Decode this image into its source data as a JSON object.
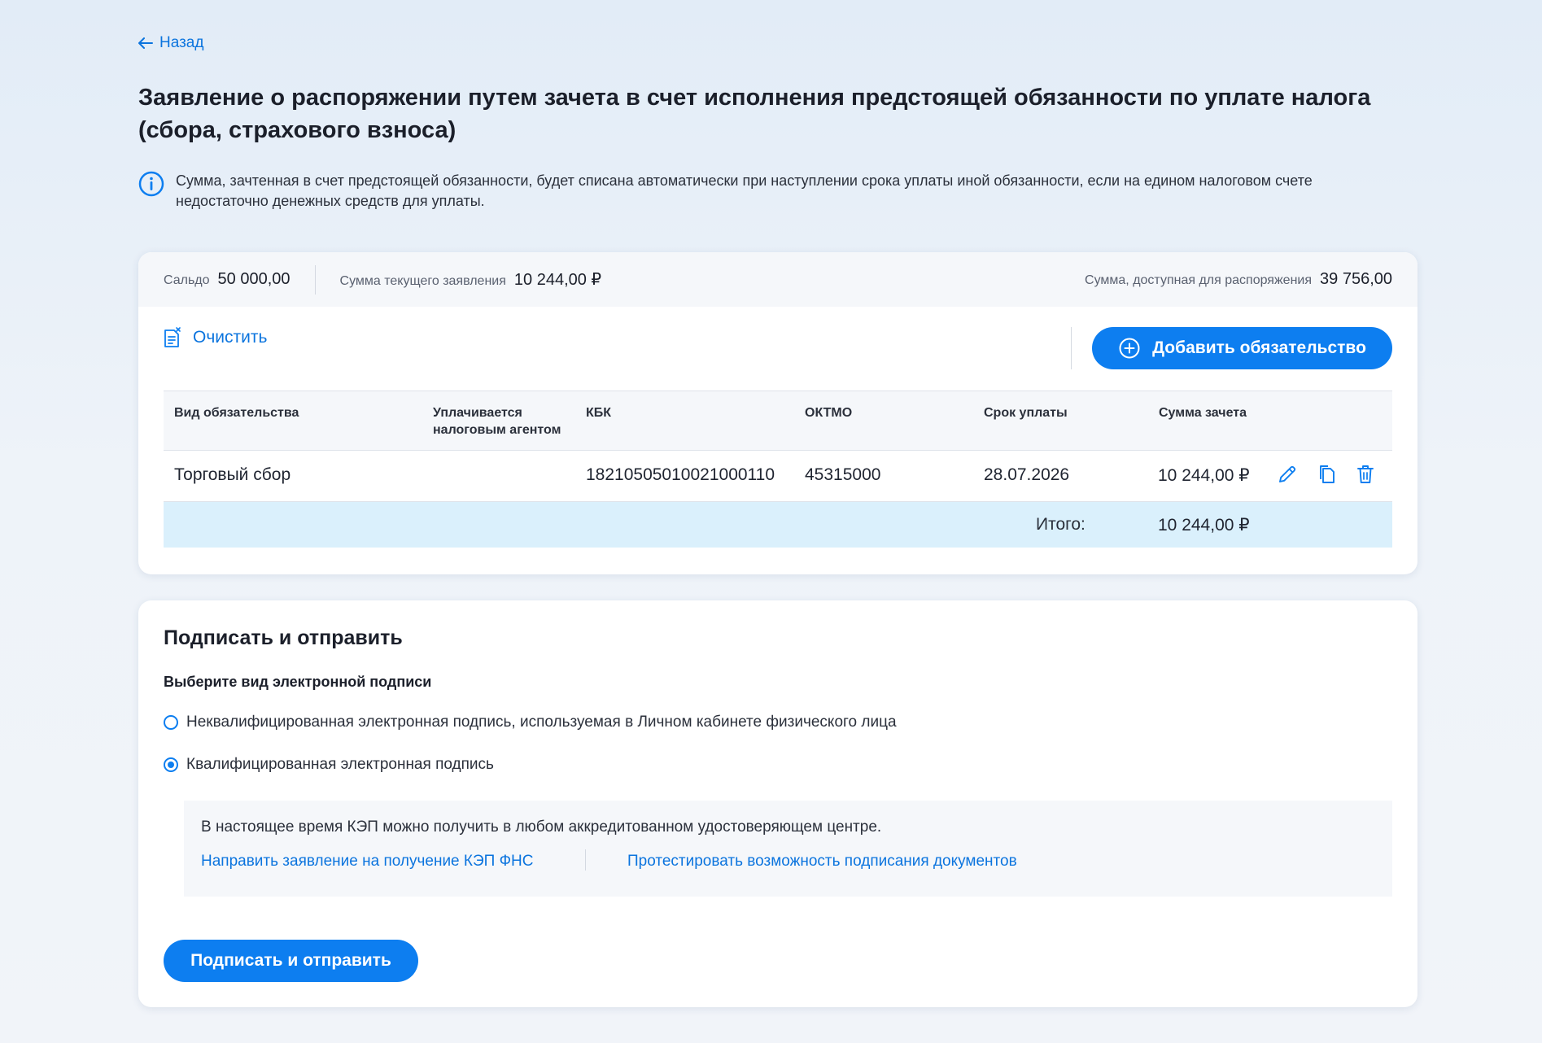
{
  "back_label": "Назад",
  "page_title": "Заявление о распоряжении путем зачета в счет исполнения предстоящей обязанности по уплате налога (сбора, страхового взноса)",
  "info_text": "Сумма, зачтенная в счет предстоящей обязанности, будет списана автоматически при наступлении срока уплаты иной обязанности, если на едином налоговом счете недостаточно денежных средств для уплаты.",
  "summary": {
    "saldo_label": "Сальдо",
    "saldo_value": "50 000,00",
    "current_label": "Сумма текущего заявления",
    "current_value": "10 244,00 ₽",
    "available_label": "Сумма, доступная для распоряжения",
    "available_value": "39 756,00"
  },
  "toolbar": {
    "clear_label": "Очистить",
    "add_label": "Добавить обязательство"
  },
  "table": {
    "headers": [
      "Вид обязательства",
      "Уплачивается налоговым агентом",
      "КБК",
      "ОКТМО",
      "Срок уплаты",
      "Сумма зачета"
    ],
    "rows": [
      {
        "type": "Торговый сбор",
        "agent": "",
        "kbk": "18210505010021000110",
        "oktmo": "45315000",
        "due": "28.07.2026",
        "amount": "10 244,00 ₽"
      }
    ],
    "total_label": "Итого:",
    "total_value": "10 244,00 ₽"
  },
  "sign": {
    "title": "Подписать и отправить",
    "subtitle": "Выберите вид электронной подписи",
    "option_unqualified": "Неквалифицированная электронная подпись, используемая в Личном кабинете физического лица",
    "option_qualified": "Квалифицированная электронная подпись",
    "selected": "qualified",
    "kep_info": "В настоящее время КЭП можно получить в любом аккредитованном удостоверяющем центре.",
    "kep_link_request": "Направить заявление на получение КЭП ФНС",
    "kep_link_test": "Протестировать возможность подписания документов",
    "submit_label": "Подписать и отправить"
  },
  "colors": {
    "accent": "#0d7ef0",
    "link": "#0b74de",
    "total_row": "#daf0fc"
  }
}
